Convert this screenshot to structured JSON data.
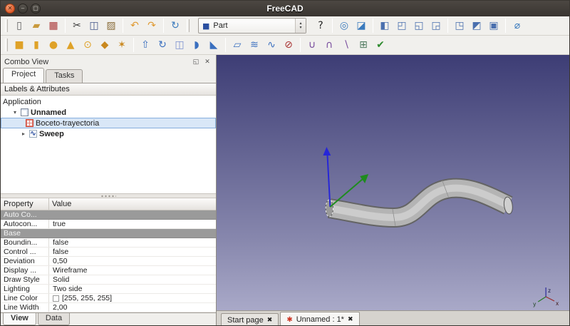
{
  "window": {
    "title": "FreeCAD"
  },
  "titlebar": {
    "buttons": [
      {
        "name": "close",
        "glyph": "✕"
      },
      {
        "name": "minimize",
        "glyph": "–"
      },
      {
        "name": "maximize",
        "glyph": "▢"
      }
    ]
  },
  "toolbars": {
    "row1_left": [
      {
        "name": "new-document",
        "glyph": "▯",
        "color": "#5a5a5a"
      },
      {
        "name": "open-document",
        "glyph": "▰",
        "color": "#c99a3d"
      },
      {
        "name": "save-document",
        "glyph": "▦",
        "color": "#a83232"
      },
      {
        "sep": true
      },
      {
        "name": "cut",
        "glyph": "✂",
        "color": "#3a3a3a"
      },
      {
        "name": "copy",
        "glyph": "◫",
        "color": "#44568a"
      },
      {
        "name": "paste",
        "glyph": "▨",
        "color": "#8a6d3b"
      },
      {
        "sep": true
      },
      {
        "name": "undo",
        "glyph": "↶",
        "color": "#e09a32"
      },
      {
        "name": "redo",
        "glyph": "↷",
        "color": "#e09a32"
      },
      {
        "sep": true
      },
      {
        "name": "refresh",
        "glyph": "↻",
        "color": "#3a7abd"
      }
    ],
    "workbench": {
      "value": "Part",
      "icon_glyph": "■",
      "spinner_up": "▴",
      "spinner_down": "▾"
    },
    "row1_right": [
      {
        "name": "whats-this",
        "glyph": "?",
        "color": "#222222"
      },
      {
        "sep": true
      },
      {
        "name": "fit-all",
        "glyph": "◎",
        "color": "#3a7abd"
      },
      {
        "name": "draw-style",
        "glyph": "◪",
        "color": "#3a7abd"
      },
      {
        "sep": true
      },
      {
        "name": "view-isometric",
        "glyph": "◧",
        "color": "#4a6fae"
      },
      {
        "name": "view-front",
        "glyph": "◰",
        "color": "#4a6fae"
      },
      {
        "name": "view-top",
        "glyph": "◱",
        "color": "#4a6fae"
      },
      {
        "name": "view-right",
        "glyph": "◲",
        "color": "#4a6fae"
      },
      {
        "sep": true
      },
      {
        "name": "view-rear",
        "glyph": "◳",
        "color": "#4a6fae"
      },
      {
        "name": "view-bottom",
        "glyph": "◩",
        "color": "#4a6fae"
      },
      {
        "name": "view-left",
        "glyph": "▣",
        "color": "#4a6fae"
      },
      {
        "sep": true
      },
      {
        "name": "measure-distance",
        "glyph": "⌀",
        "color": "#3a7abd"
      }
    ],
    "row2": [
      {
        "name": "part-box",
        "glyph": "■",
        "color": "#dfa228"
      },
      {
        "name": "part-cylinder",
        "glyph": "▮",
        "color": "#dfa228"
      },
      {
        "name": "part-sphere",
        "glyph": "●",
        "color": "#dfa228"
      },
      {
        "name": "part-cone",
        "glyph": "▲",
        "color": "#dfa228"
      },
      {
        "name": "part-torus",
        "glyph": "⊙",
        "color": "#dfa228"
      },
      {
        "name": "create-primitives",
        "glyph": "◆",
        "color": "#c9881e"
      },
      {
        "name": "shape-builder",
        "glyph": "✶",
        "color": "#c9881e"
      },
      {
        "sep": true
      },
      {
        "name": "extrude",
        "glyph": "⇧",
        "color": "#3a6fbf"
      },
      {
        "name": "revolve",
        "glyph": "↻",
        "color": "#3a6fbf"
      },
      {
        "name": "mirror",
        "glyph": "◫",
        "color": "#7a8fcf"
      },
      {
        "name": "fillet",
        "glyph": "◗",
        "color": "#3a6fbf"
      },
      {
        "name": "chamfer",
        "glyph": "◣",
        "color": "#3a6fbf"
      },
      {
        "sep": true
      },
      {
        "name": "ruled-surface",
        "glyph": "▱",
        "color": "#3a6fbf"
      },
      {
        "name": "loft",
        "glyph": "≋",
        "color": "#3a6fbf"
      },
      {
        "name": "sweep",
        "glyph": "∿",
        "color": "#3a6fbf"
      },
      {
        "name": "section",
        "glyph": "⊘",
        "color": "#a83232"
      },
      {
        "sep": true
      },
      {
        "name": "boolean-union",
        "glyph": "∪",
        "color": "#7a4f9f"
      },
      {
        "name": "boolean-common",
        "glyph": "∩",
        "color": "#7a4f9f"
      },
      {
        "name": "boolean-cut",
        "glyph": "∖",
        "color": "#7a4f9f"
      },
      {
        "name": "compound",
        "glyph": "⊞",
        "color": "#4f7a5f"
      },
      {
        "name": "check-geometry",
        "glyph": "✔",
        "color": "#2e8b2e"
      }
    ]
  },
  "combo_view": {
    "title": "Combo View",
    "window_buttons": [
      {
        "name": "float-panel",
        "glyph": "◱"
      },
      {
        "name": "close-panel",
        "glyph": "✕"
      }
    ],
    "tabs": [
      {
        "label": "Project",
        "active": true
      },
      {
        "label": "Tasks",
        "active": false
      }
    ],
    "tree_header": "Labels & Attributes",
    "tree": [
      {
        "label": "Application",
        "depth": 0,
        "bold": false
      },
      {
        "label": "Unnamed",
        "depth": 1,
        "bold": true,
        "expander": "▾",
        "icon": "document"
      },
      {
        "label": "Boceto-trayectoria",
        "depth": 2,
        "bold": false,
        "icon": "sketch",
        "selected": true
      },
      {
        "label": "Sweep",
        "depth": 2,
        "bold": true,
        "expander": "▸",
        "icon": "sweep",
        "icon_glyph": "∿"
      }
    ]
  },
  "properties": {
    "columns": [
      "Property",
      "Value"
    ],
    "rows": [
      {
        "type": "group",
        "label": "Auto Co..."
      },
      {
        "type": "item",
        "label": "Autocon...",
        "value": "true"
      },
      {
        "type": "group",
        "label": "Base"
      },
      {
        "type": "item",
        "label": "Boundin...",
        "value": "false"
      },
      {
        "type": "item",
        "label": "Control ...",
        "value": "false"
      },
      {
        "type": "item",
        "label": "Deviation",
        "value": "0,50"
      },
      {
        "type": "item",
        "label": "Display ...",
        "value": "Wireframe"
      },
      {
        "type": "item",
        "label": "Draw Style",
        "value": "Solid"
      },
      {
        "type": "item",
        "label": "Lighting",
        "value": "Two side"
      },
      {
        "type": "item",
        "label": "Line Color",
        "value": "[255, 255, 255]",
        "swatch": "#ffffff"
      },
      {
        "type": "item",
        "label": "Line Width",
        "value": "2,00"
      }
    ]
  },
  "panel_tabs": [
    {
      "label": "View",
      "active": true
    },
    {
      "label": "Data",
      "active": false
    }
  ],
  "viewport": {
    "doc_tabs": [
      {
        "label": "Start page",
        "active": false
      },
      {
        "label": "Unnamed : 1*",
        "active": true,
        "icon": "freecad",
        "icon_glyph": "✱",
        "icon_color": "#cc3322"
      }
    ],
    "close_glyph": "✖",
    "nav_axes": [
      "x",
      "y",
      "z"
    ],
    "background_top": "#3d3d75",
    "background_bottom": "#a9a9c8"
  }
}
